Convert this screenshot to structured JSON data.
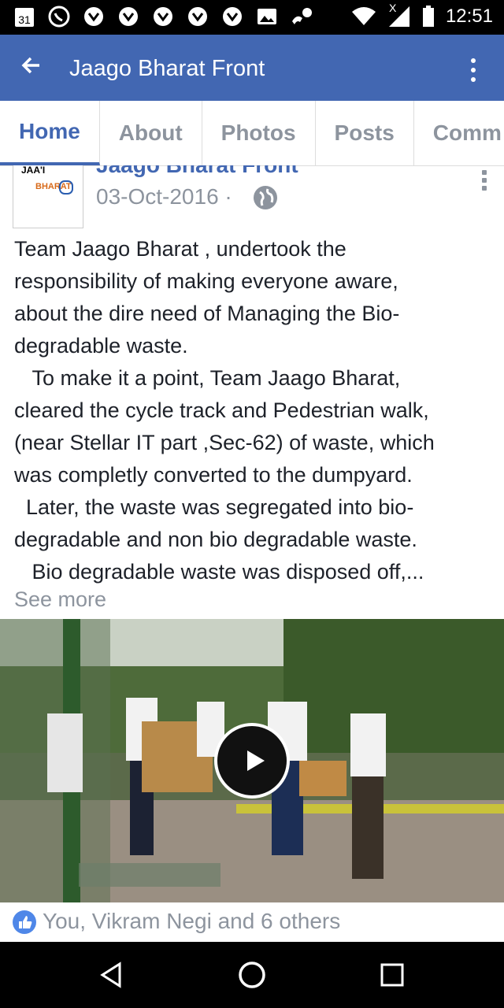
{
  "statusbar": {
    "date_badge": "31",
    "time": "12:51",
    "network_badge": "X"
  },
  "appbar": {
    "title": "Jaago Bharat Front"
  },
  "tabs": [
    {
      "label": "Home",
      "active": true
    },
    {
      "label": "About",
      "active": false
    },
    {
      "label": "Photos",
      "active": false
    },
    {
      "label": "Posts",
      "active": false
    },
    {
      "label": "Comm",
      "active": false
    }
  ],
  "post": {
    "page_name": "Jaago Bharat Front",
    "date": "03-Oct-2016",
    "separator": "·",
    "avatar_text": "JAA'I",
    "avatar_subtext": "BHARAT",
    "body": "Team Jaago Bharat , undertook the\nresponsibility of making everyone aware,\nabout the dire need of Managing the Bio-\ndegradable waste.\n   To make it a point, Team Jaago Bharat,\ncleared the cycle track and Pedestrian walk,\n(near Stellar IT part ,Sec-62) of waste, which\nwas completly converted to the dumpyard.\n  Later, the waste was segregated into bio-\ndegradable and non bio degradable waste.\n   Bio degradable waste was disposed off,...",
    "see_more": "See more",
    "reactions_text": "You, Vikram Negi and 6 others"
  },
  "colors": {
    "brand": "#4267b2",
    "muted": "#8d949e",
    "text": "#1d2129",
    "like_blue": "#4f87e8"
  },
  "icons": {
    "back": "arrow-left-icon",
    "menu": "more-vertical-icon",
    "privacy": "globe-icon",
    "play": "play-icon",
    "like": "like-icon"
  }
}
